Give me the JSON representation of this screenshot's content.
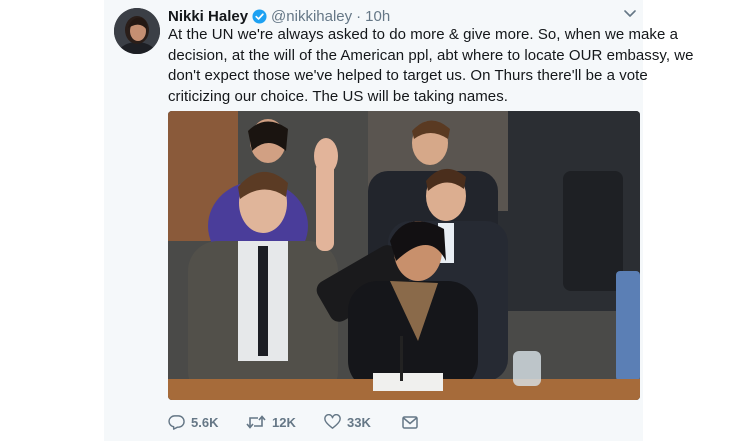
{
  "tweet": {
    "author_name": "Nikki Haley",
    "handle": "@nikkihaley",
    "separator": "·",
    "time": "10h",
    "text_lines": [
      "At the UN we're always asked to do more & give more. So, when we make a",
      "decision, at the will of the American ppl, abt where to locate OUR embassy, we",
      "don't expect those we've helped to target us. On Thurs there'll be a vote",
      "criticizing our choice. The US will be taking names."
    ]
  },
  "actions": {
    "replies": "5.6K",
    "retweets": "12K",
    "likes": "33K"
  },
  "icons": {
    "verified": "verified-badge-icon",
    "caret": "chevron-down-icon",
    "reply": "reply-icon",
    "retweet": "retweet-icon",
    "like": "heart-icon",
    "dm": "envelope-icon"
  },
  "colors": {
    "verified": "#1da1f2",
    "muted": "#657786",
    "text": "#14171a",
    "card_bg": "#f5f8fa"
  }
}
